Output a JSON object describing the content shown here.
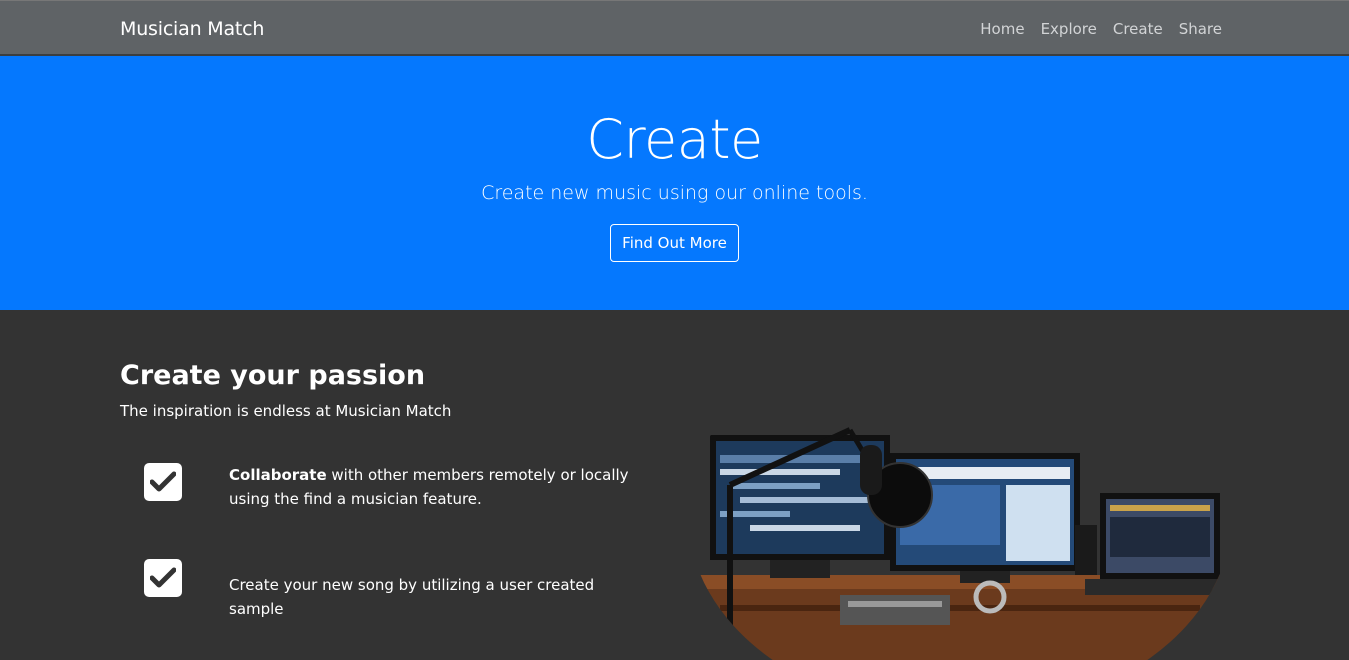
{
  "nav": {
    "brand": "Musician Match",
    "links": [
      "Home",
      "Explore",
      "Create",
      "Share"
    ]
  },
  "hero": {
    "title": "Create",
    "subtitle": "Create new music using our online tools.",
    "button_label": "Find Out More"
  },
  "section": {
    "title": "Create your passion",
    "subtitle": "The inspiration is endless at Musician Match",
    "features": [
      {
        "bold": "Collaborate",
        "text": " with other members remotely or locally using the find a musician feature."
      },
      {
        "bold": "",
        "text": "Create your new song by utilizing a user created sample"
      }
    ]
  },
  "colors": {
    "navbar": "#5f6366",
    "hero": "#0578fe",
    "section": "#333333"
  },
  "icons": [
    "check-icon",
    "studio-image"
  ]
}
